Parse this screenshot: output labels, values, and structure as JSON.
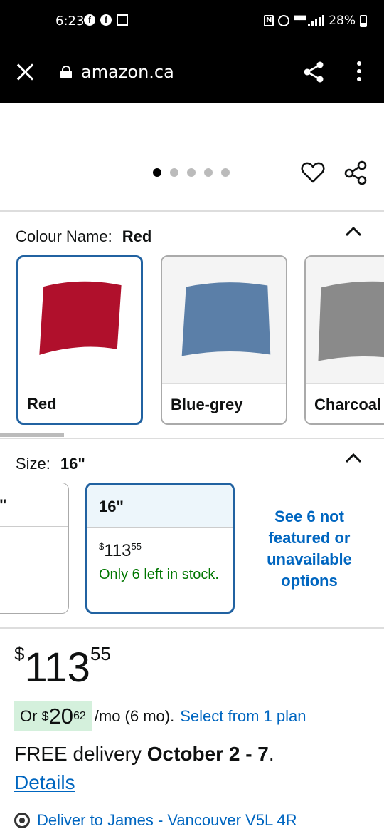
{
  "status_bar": {
    "time": "6:23",
    "battery": "28%",
    "icons": [
      "facebook-icon",
      "facebook-icon",
      "gallery-icon",
      "nfc-icon",
      "alarm-icon",
      "wifi-calling-icon",
      "signal-icon",
      "battery-icon"
    ]
  },
  "browser": {
    "url": "amazon.ca",
    "icons": [
      "close-icon",
      "lock-icon",
      "share-icon",
      "more-vert-icon"
    ]
  },
  "gallery": {
    "dot_count": 5,
    "active_dot": 0,
    "icons": [
      "heart-icon",
      "share-icon"
    ]
  },
  "colour": {
    "label": "Colour Name:",
    "selected": "Red",
    "options": [
      {
        "name": "Red",
        "color": "#b0102c"
      },
      {
        "name": "Blue-grey",
        "color": "#5b7fa8"
      },
      {
        "name": "Charcoal",
        "color": "#8a8a8a"
      }
    ]
  },
  "size": {
    "label": "Size:",
    "selected": "16\"",
    "prev_option": "\"",
    "card": {
      "title": "16\"",
      "price_currency": "$",
      "price_main": "113",
      "price_fraction": "55",
      "stock": "Only 6 left in stock."
    },
    "see_more": "See 6 not featured or unavailable options"
  },
  "price": {
    "currency": "$",
    "main": "113",
    "fraction": "55"
  },
  "monthly": {
    "prefix": "Or",
    "currency": "$",
    "amount": "20",
    "fraction": "62",
    "suffix": "/mo (6 mo).",
    "link": "Select from 1 plan"
  },
  "delivery": {
    "prefix": "FREE delivery",
    "dates": "October 2 - 7",
    "end": ".",
    "details": "Details",
    "deliver_to": "Deliver to James - Vancouver V5L 4R"
  },
  "colors": {
    "link": "#0066c0",
    "selected_border": "#2162a1",
    "stock_green": "#007600",
    "monthly_badge": "#d4f0dc"
  }
}
